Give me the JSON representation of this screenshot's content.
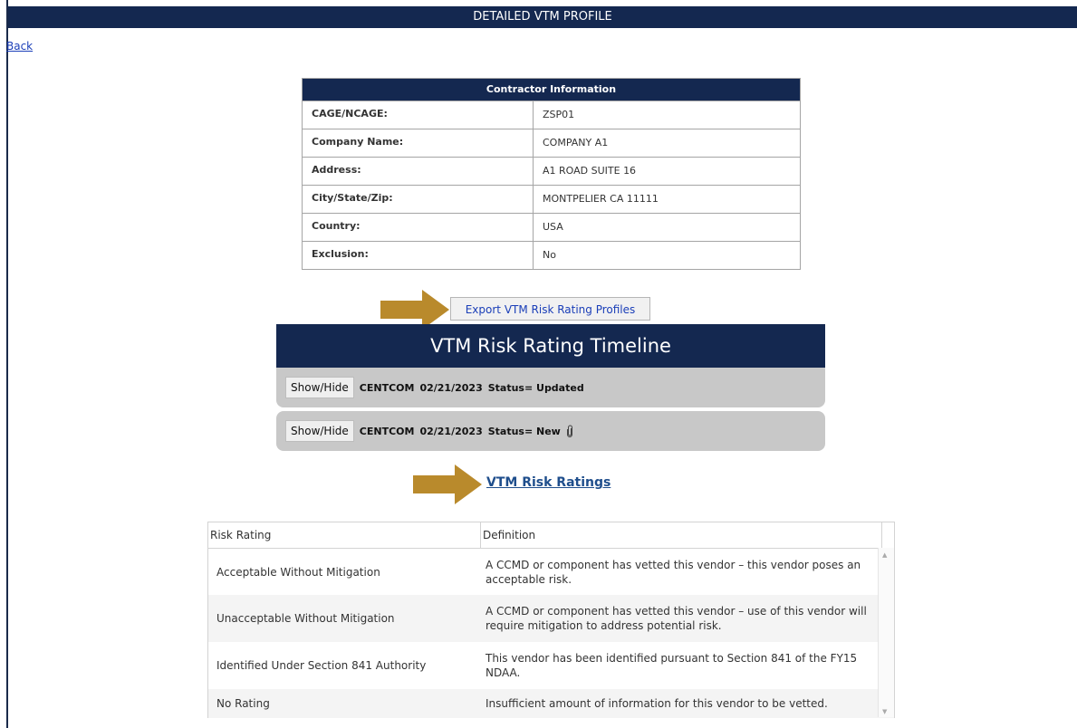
{
  "page": {
    "title": "DETAILED VTM PROFILE",
    "back_label": "Back"
  },
  "contractor": {
    "header": "Contractor Information",
    "rows": [
      {
        "label": "CAGE/NCAGE:",
        "value": "ZSP01"
      },
      {
        "label": "Company Name:",
        "value": "COMPANY A1"
      },
      {
        "label": "Address:",
        "value": "A1 ROAD SUITE 16"
      },
      {
        "label": "City/State/Zip:",
        "value": "MONTPELIER CA 11111"
      },
      {
        "label": "Country:",
        "value": "USA"
      },
      {
        "label": "Exclusion:",
        "value": "No"
      }
    ]
  },
  "export_button": "Export VTM Risk Rating Profiles",
  "timeline": {
    "title": "VTM Risk Rating Timeline",
    "entries": [
      {
        "button": "Show/Hide",
        "command": "CENTCOM",
        "date": "02/21/2023",
        "status": "Status= Updated",
        "attachment": false
      },
      {
        "button": "Show/Hide",
        "command": "CENTCOM",
        "date": "02/21/2023",
        "status": "Status= New",
        "attachment": true
      }
    ]
  },
  "ratings_link": "VTM Risk Ratings",
  "ratings_table": {
    "headers": [
      "Risk Rating",
      "Definition"
    ],
    "rows": [
      {
        "rating": "Acceptable Without Mitigation",
        "definition": "A CCMD or component has vetted this vendor – this vendor poses an acceptable risk."
      },
      {
        "rating": "Unacceptable Without Mitigation",
        "definition": "A CCMD or component has vetted this vendor – use of this vendor will require mitigation to address potential risk."
      },
      {
        "rating": "Identified Under Section 841 Authority",
        "definition": "This vendor has been identified pursuant to Section 841 of the FY15 NDAA."
      },
      {
        "rating": "No Rating",
        "definition": "Insufficient amount of information for this vendor to be vetted."
      }
    ]
  },
  "colors": {
    "navy": "#142850",
    "arrow": "#B98A2C",
    "link": "#1a3eb8"
  },
  "icons": [
    "arrow-right-icon",
    "paperclip-icon",
    "scroll-up-icon",
    "scroll-down-icon"
  ]
}
